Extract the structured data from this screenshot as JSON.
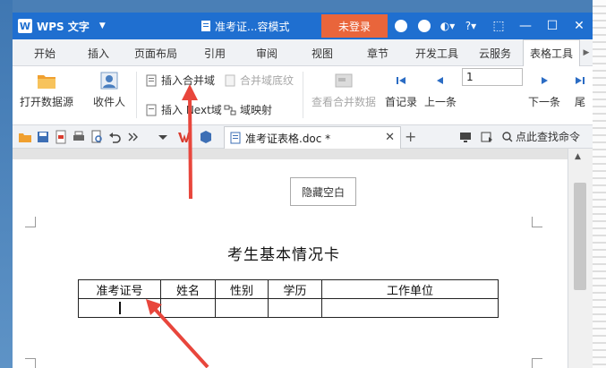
{
  "app": {
    "name": "WPS 文字",
    "doc_title": "准考证...容模式",
    "login_label": "未登录",
    "help_label": "?"
  },
  "menu": {
    "tabs": [
      "开始",
      "插入",
      "页面布局",
      "引用",
      "审阅",
      "视图",
      "章节",
      "开发工具",
      "云服务",
      "表格工具"
    ],
    "active_index": 9
  },
  "ribbon": {
    "open_source": "打开数据源",
    "recipients": "收件人",
    "insert_merge_field": "插入合并域",
    "merge_field_shading": "合并域底纹",
    "insert_next_field": "插入 Next域",
    "field_mapping": "域映射",
    "view_merge_data": "查看合并数据",
    "prev_record": "首记录",
    "prev_one": "上一条",
    "record_value": "1",
    "next_one": "下一条",
    "last_record": "尾"
  },
  "quickbar": {
    "doc_tab_label": "准考证表格.doc *",
    "find_command": "点此查找命令"
  },
  "document": {
    "hide_space_button": "隐藏空白",
    "card_title": "考生基本情况卡",
    "table_headers": [
      "准考证号",
      "姓名",
      "性别",
      "学历",
      "工作单位"
    ]
  },
  "colors": {
    "titlebar": "#1f6fd0",
    "login_button": "#e9653b",
    "annotation_arrow": "#e8463c"
  }
}
